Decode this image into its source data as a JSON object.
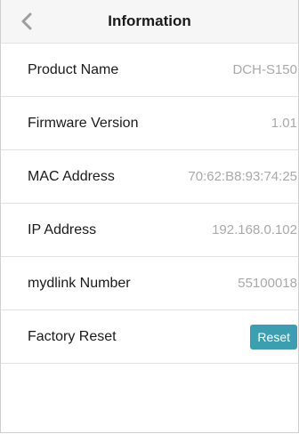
{
  "header": {
    "title": "Information",
    "back_icon": "chevron-left-icon"
  },
  "rows": [
    {
      "label": "Product Name",
      "value": "DCH-S150"
    },
    {
      "label": "Firmware Version",
      "value": "1.01"
    },
    {
      "label": "MAC Address",
      "value": "70:62:B8:93:74:25"
    },
    {
      "label": "IP Address",
      "value": "192.168.0.102"
    },
    {
      "label": "mydlink Number",
      "value": "55100018"
    }
  ],
  "factory_reset": {
    "label": "Factory Reset",
    "button_label": "Reset"
  },
  "colors": {
    "accent": "#3d9eb0",
    "value_text": "#a9a9a9",
    "header_bg": "#f6f6f6"
  }
}
